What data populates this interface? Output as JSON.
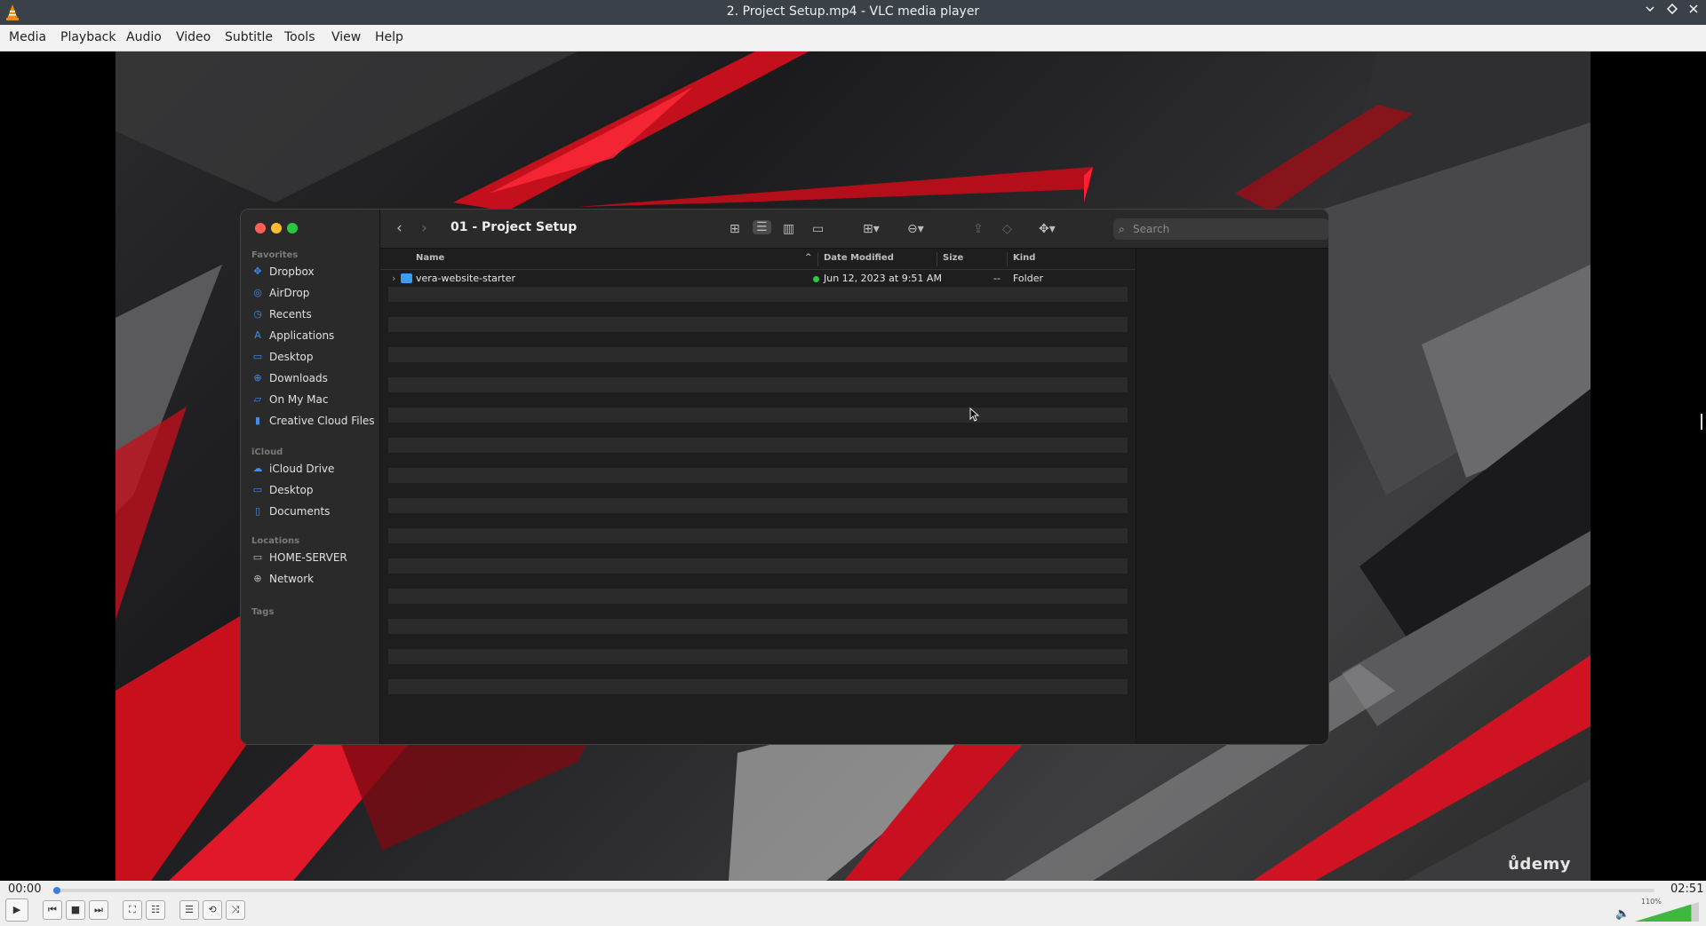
{
  "window": {
    "title": "2. Project Setup.mp4 - VLC media player",
    "minimize_icon": "chevron-down-icon",
    "restore_icon": "diamond-restore-icon",
    "close_icon": "close-icon"
  },
  "menu": [
    "Media",
    "Playback",
    "Audio",
    "Video",
    "Subtitle",
    "Tools",
    "View",
    "Help"
  ],
  "video": {
    "watermark": "ůdemy",
    "finder": {
      "title": "01 - Project Setup",
      "search_placeholder": "Search",
      "sidebar": {
        "favorites_label": "Favorites",
        "favorites": [
          {
            "label": "Dropbox",
            "icon": "dropbox-icon"
          },
          {
            "label": "AirDrop",
            "icon": "airdrop-icon"
          },
          {
            "label": "Recents",
            "icon": "clock-icon"
          },
          {
            "label": "Applications",
            "icon": "applications-icon"
          },
          {
            "label": "Desktop",
            "icon": "desktop-icon"
          },
          {
            "label": "Downloads",
            "icon": "download-icon"
          },
          {
            "label": "On My Mac",
            "icon": "folder-icon"
          },
          {
            "label": "Creative Cloud Files",
            "icon": "document-icon"
          }
        ],
        "icloud_label": "iCloud",
        "icloud": [
          {
            "label": "iCloud Drive",
            "icon": "cloud-icon"
          },
          {
            "label": "Desktop",
            "icon": "desktop-icon"
          },
          {
            "label": "Documents",
            "icon": "document-icon"
          }
        ],
        "locations_label": "Locations",
        "locations": [
          {
            "label": "HOME-SERVER",
            "icon": "monitor-icon"
          },
          {
            "label": "Network",
            "icon": "globe-icon"
          }
        ],
        "tags_label": "Tags"
      },
      "columns": {
        "name": "Name",
        "date": "Date Modified",
        "size": "Size",
        "kind": "Kind"
      },
      "files": [
        {
          "name": "vera-website-starter",
          "date": "Jun 12, 2023 at 9:51 AM",
          "size": "--",
          "kind": "Folder"
        }
      ]
    }
  },
  "controls": {
    "elapsed": "00:00",
    "total": "02:51",
    "progress_fraction": 0.0,
    "volume_label": "110%",
    "volume_fraction": 0.88,
    "buttons": [
      "play",
      "previous",
      "stop",
      "next",
      "fullscreen",
      "extended-settings",
      "playlist",
      "loop",
      "random"
    ]
  }
}
